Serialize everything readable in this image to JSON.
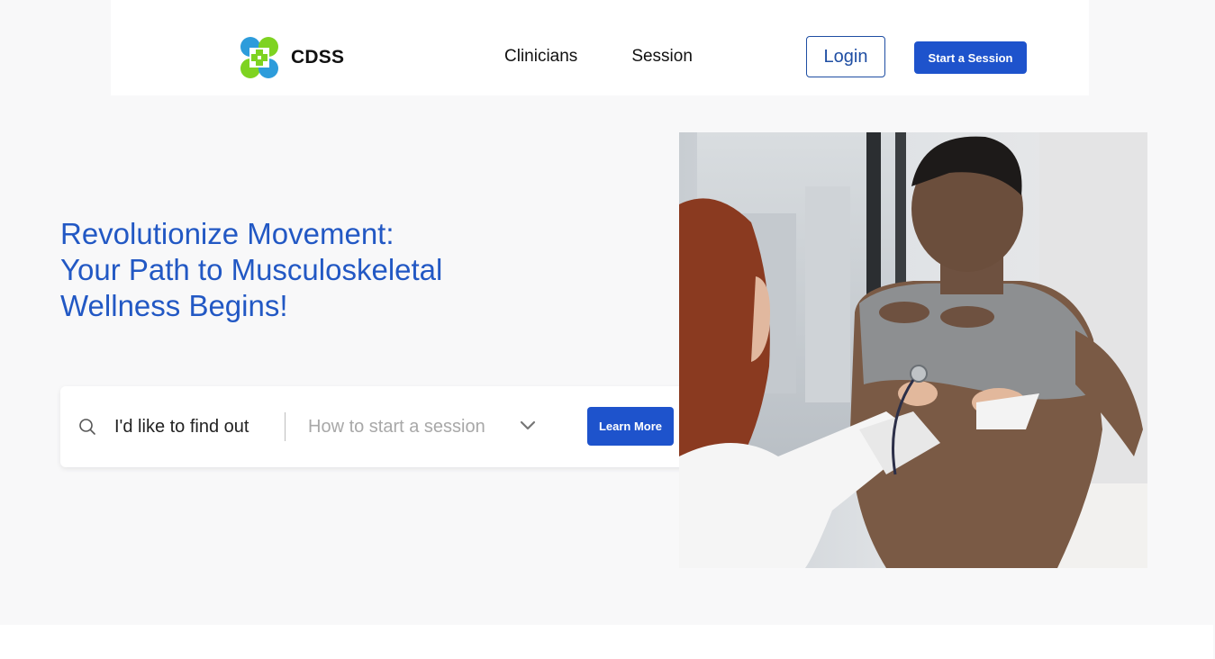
{
  "brand": {
    "name": "CDSS",
    "logo_icon": "medical-cross-clover-icon",
    "colors": {
      "green": "#7ed321",
      "blue": "#2d9cdb"
    }
  },
  "nav": {
    "items": [
      {
        "label": "Clinicians"
      },
      {
        "label": "Session"
      }
    ],
    "login_label": "Login",
    "start_label": "Start a Session"
  },
  "hero": {
    "title_line1": "Revolutionize Movement:",
    "title_line2": "Your Path to Musculoskeletal",
    "title_line3": "Wellness Begins!",
    "title_color": "#2258c4"
  },
  "search": {
    "icon": "search-icon",
    "label": "I'd like to find out",
    "selected_option": "How to start a session",
    "dropdown_icon": "chevron-down-icon",
    "button_label": "Learn More"
  },
  "colors": {
    "primary": "#1e53cc",
    "background": "#f8f8f9"
  }
}
